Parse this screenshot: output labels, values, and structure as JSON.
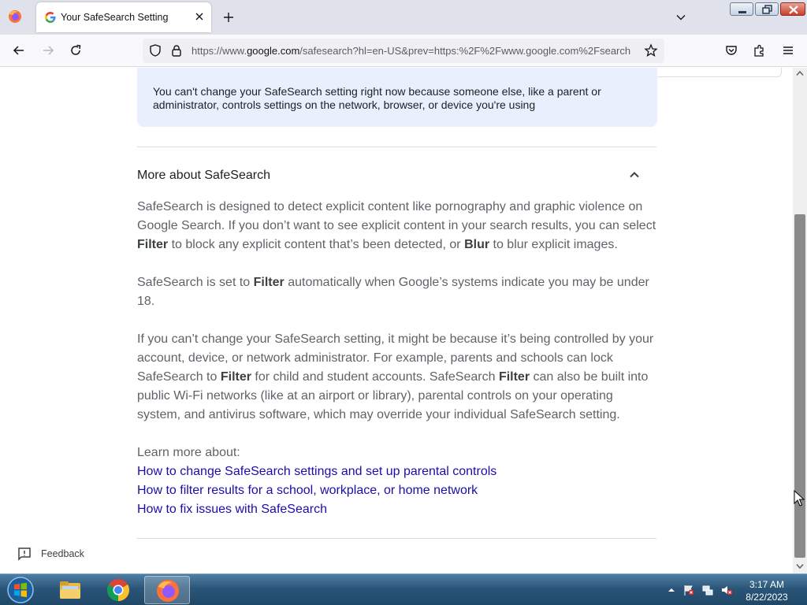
{
  "browser": {
    "tab": {
      "title": "Your SafeSearch Setting",
      "favicon": "google-g-icon"
    },
    "url": {
      "prefix": "https://www.",
      "domain": "google.com",
      "rest": "/safesearch?hl=en-US&prev=https:%2F%2Fwww.google.com%2Fsearch"
    }
  },
  "page": {
    "notice": "You can't change your SafeSearch setting right now because someone else, like a parent or administrator, controls settings on the network, browser, or device you're using",
    "section_title": "More about SafeSearch",
    "p1": {
      "a": "SafeSearch is designed to detect explicit content like pornography and graphic violence on Google Search. If you don’t want to see explicit content in your search results, you can select ",
      "b": "Filter",
      "c": " to block any explicit content that’s been detected, or ",
      "d": "Blur",
      "e": " to blur explicit images."
    },
    "p2": {
      "a": "SafeSearch is set to ",
      "b": "Filter",
      "c": " automatically when Google’s systems indicate you may be under 18."
    },
    "p3": {
      "a": "If you can’t change your SafeSearch setting, it might be because it’s being controlled by your account, device, or network administrator. For example, parents and schools can lock SafeSearch to ",
      "b": "Filter",
      "c": " for child and student accounts. SafeSearch ",
      "d": "Filter",
      "e": " can also be built into public Wi-Fi networks (like at an airport or library), parental controls on your operating system, and antivirus software, which may override your individual SafeSearch setting."
    },
    "learn_more": "Learn more about:",
    "links": [
      "How to change SafeSearch settings and set up parental controls",
      "How to filter results for a school, workplace, or home network",
      "How to fix issues with SafeSearch"
    ],
    "feedback": "Feedback"
  },
  "taskbar": {
    "time": "3:17 AM",
    "date": "8/22/2023"
  },
  "colors": {
    "link": "#1a0dab",
    "notice_bg": "#e8f0fe",
    "accent": "#1a73e8"
  }
}
